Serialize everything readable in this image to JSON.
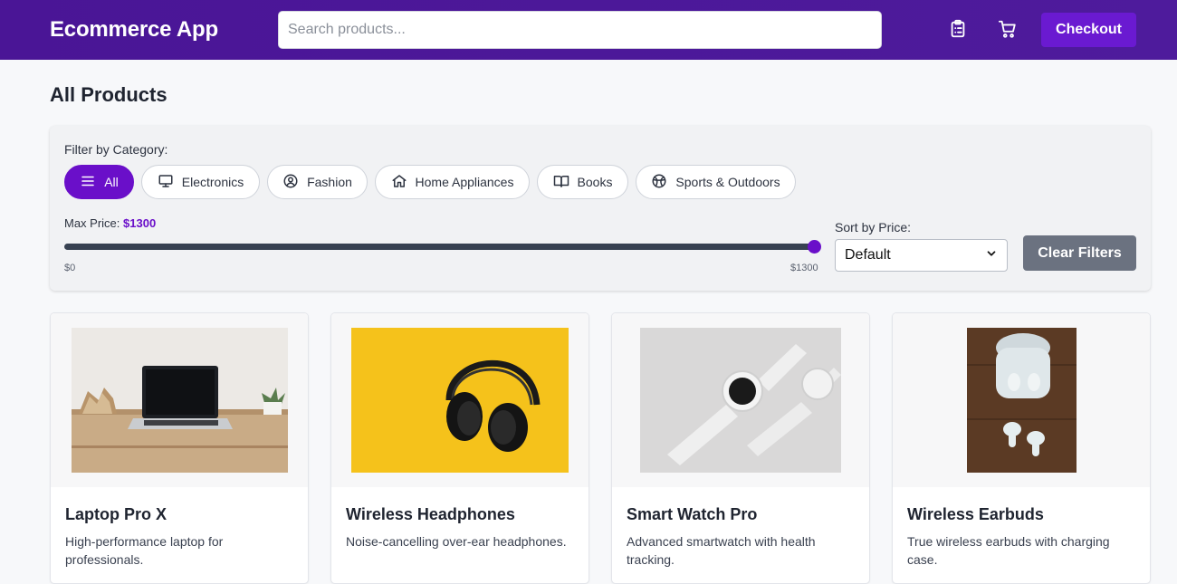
{
  "header": {
    "brand": "Ecommerce App",
    "search_placeholder": "Search products...",
    "orders_icon": "clipboard-list-icon",
    "cart_icon": "shopping-cart-icon",
    "checkout_label": "Checkout"
  },
  "page": {
    "title": "All Products"
  },
  "filters": {
    "category_label": "Filter by Category:",
    "categories": [
      {
        "label": "All",
        "icon": "menu-icon",
        "active": true
      },
      {
        "label": "Electronics",
        "icon": "monitor-icon",
        "active": false
      },
      {
        "label": "Fashion",
        "icon": "user-circle-icon",
        "active": false
      },
      {
        "label": "Home Appliances",
        "icon": "home-icon",
        "active": false
      },
      {
        "label": "Books",
        "icon": "book-open-icon",
        "active": false
      },
      {
        "label": "Sports & Outdoors",
        "icon": "globe-ball-icon",
        "active": false
      }
    ],
    "max_price_label": "Max Price:",
    "max_price_value": "$1300",
    "range_min": "$0",
    "range_max": "$1300",
    "slider_fraction": 1.0,
    "sort_label": "Sort by Price:",
    "sort_selected": "Default",
    "clear_label": "Clear Filters"
  },
  "products": [
    {
      "name": "Laptop Pro X",
      "description": "High-performance laptop for professionals.",
      "image": "laptop-photo"
    },
    {
      "name": "Wireless Headphones",
      "description": "Noise-cancelling over-ear headphones.",
      "image": "headphones-photo"
    },
    {
      "name": "Smart Watch Pro",
      "description": "Advanced smartwatch with health tracking.",
      "image": "smartwatch-photo"
    },
    {
      "name": "Wireless Earbuds",
      "description": "True wireless earbuds with charging case.",
      "image": "earbuds-photo"
    }
  ],
  "colors": {
    "header_bg": "#4e1b9c",
    "accent": "#6a0fc9",
    "clear_button": "#6b7280"
  }
}
